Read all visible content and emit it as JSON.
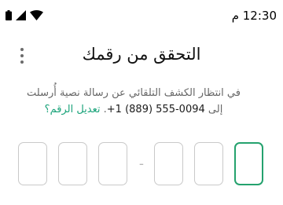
{
  "status_bar": {
    "time": "12:30 م",
    "icons": [
      "battery-icon",
      "signal-icon",
      "wifi-icon"
    ]
  },
  "header": {
    "title": "التحقق من رقمك",
    "menu_icon": "more-vertical-icon"
  },
  "description": {
    "line1": "في انتظار الكشف التلقائي عن رسالة نصية أُرسلت",
    "line2_prefix": "إلى",
    "phone_number": "+1 (889) 555-0094",
    "line2_suffix": ".",
    "edit_link": "تعديل الرقم؟"
  },
  "code_input": {
    "separator": "-",
    "digits": [
      "",
      "",
      "",
      "",
      "",
      ""
    ],
    "active_index": 0
  },
  "colors": {
    "accent": "#25a26e",
    "link": "#1aa37a",
    "box_border": "#c9c9c9"
  }
}
